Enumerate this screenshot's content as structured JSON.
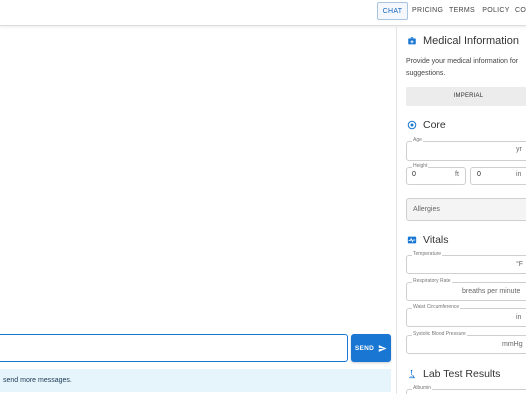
{
  "nav": {
    "items": [
      {
        "label": "CHAT",
        "active": true
      },
      {
        "label": "PRICING",
        "active": false
      },
      {
        "label": "TERMS",
        "active": false
      },
      {
        "label": "POLICY",
        "active": false
      },
      {
        "label": "CO",
        "active": false
      }
    ]
  },
  "chat": {
    "input_value": "",
    "send_label": "SEND",
    "info_message": "send more messages."
  },
  "sidebar": {
    "title": "Medical Information",
    "description": "Provide your medical information for suggestions.",
    "unit_system": "IMPERIAL",
    "core": {
      "title": "Core",
      "age_label": "Age",
      "age_unit": "yr",
      "height_label": "Height",
      "height_ft_value": "0",
      "height_ft_unit": "ft",
      "height_in_value": "0",
      "height_in_unit": "in",
      "allergies_placeholder": "Allergies"
    },
    "vitals": {
      "title": "Vitals",
      "temperature_label": "Temperature",
      "temperature_unit": "°F",
      "respiratory_label": "Respiratory Rate",
      "respiratory_unit": "breaths per minute",
      "waist_label": "Waist Circumference",
      "waist_unit": "in",
      "bp_label": "Systolic Blood Pressure",
      "bp_unit": "mmHg"
    },
    "labs": {
      "title": "Lab Test Results",
      "albumin_label": "Albumin"
    }
  },
  "colors": {
    "primary": "#1976d2",
    "info_bg": "#e6f4fb"
  }
}
